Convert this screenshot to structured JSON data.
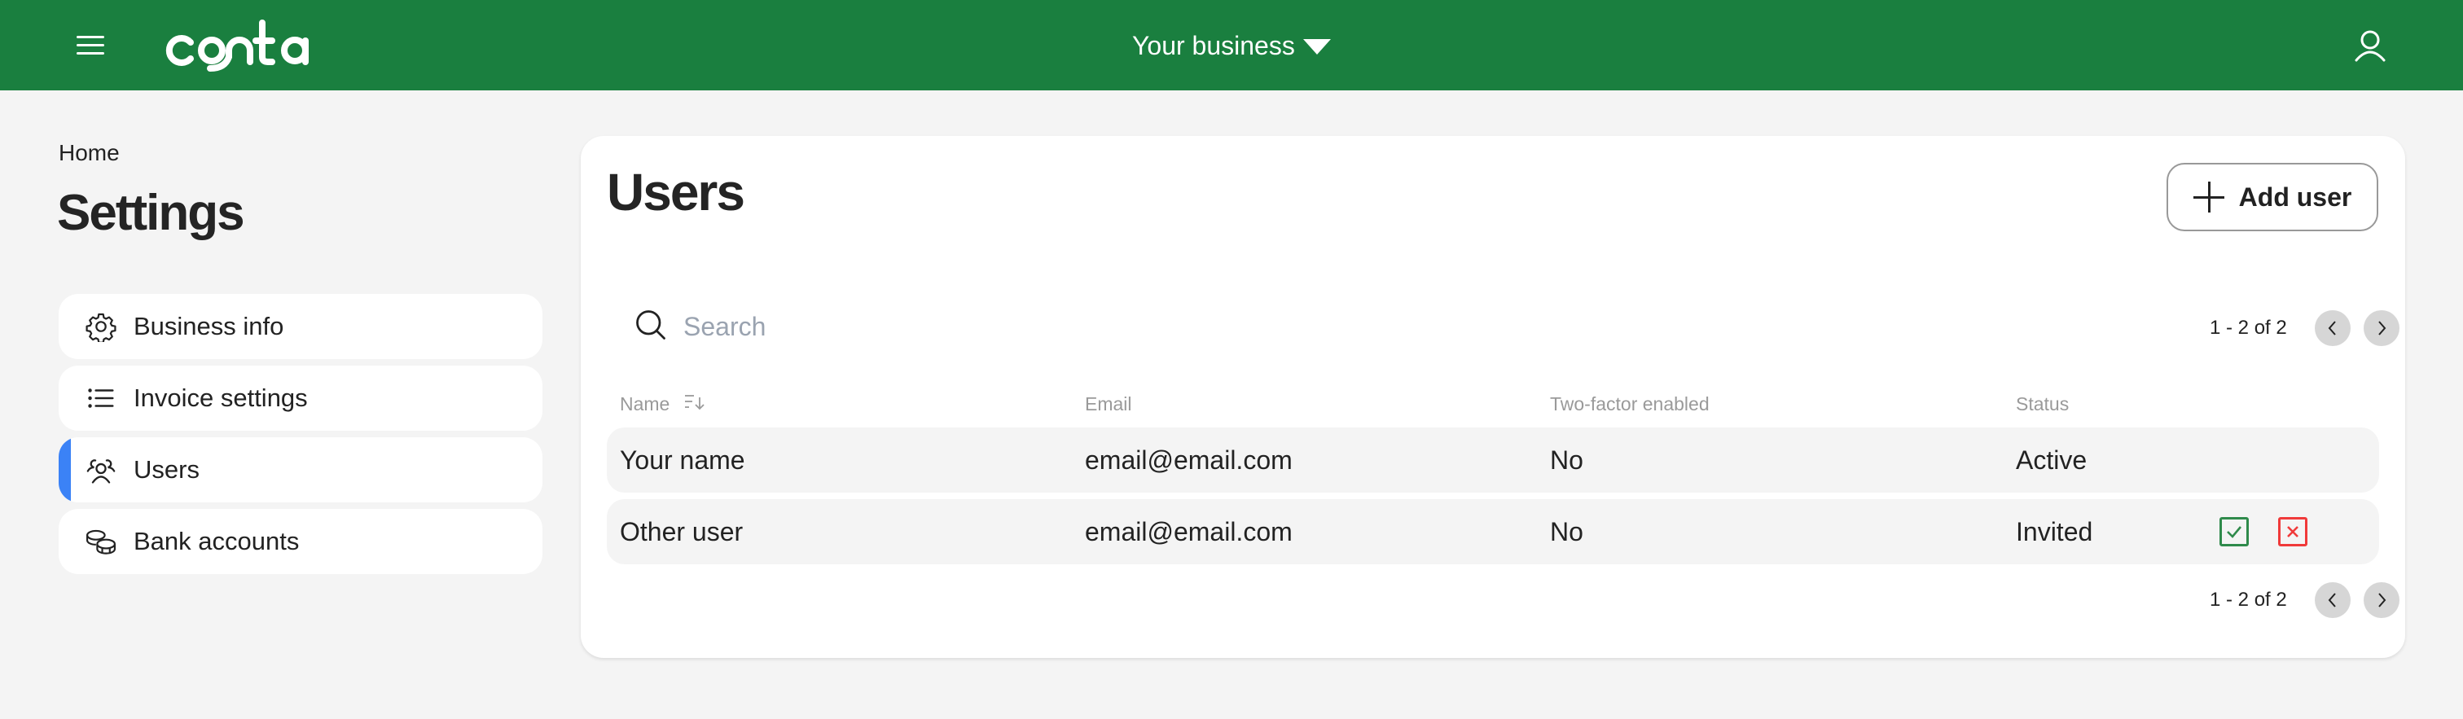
{
  "header": {
    "logo_text": "conta",
    "business_selector": "Your business",
    "brand_color": "#1a7f3f"
  },
  "breadcrumb": "Home",
  "page_title": "Settings",
  "sidebar": {
    "items": [
      {
        "label": "Business info",
        "icon": "gear-icon",
        "active": false
      },
      {
        "label": "Invoice settings",
        "icon": "list-icon",
        "active": false
      },
      {
        "label": "Users",
        "icon": "users-icon",
        "active": true
      },
      {
        "label": "Bank accounts",
        "icon": "coins-icon",
        "active": false
      }
    ],
    "active_indicator_color": "#3b82f6"
  },
  "main": {
    "title": "Users",
    "add_user_label": "Add user",
    "search_placeholder": "Search",
    "search_value": "",
    "pagination": {
      "range_text": "1 - 2 of 2"
    },
    "table": {
      "columns": [
        "Name",
        "Email",
        "Two-factor enabled",
        "Status"
      ],
      "rows": [
        {
          "name": "Your name",
          "email": "email@email.com",
          "two_factor": "No",
          "status": "Active",
          "actions": []
        },
        {
          "name": "Other user",
          "email": "email@email.com",
          "two_factor": "No",
          "status": "Invited",
          "actions": [
            "accept",
            "reject"
          ]
        }
      ]
    },
    "action_colors": {
      "accept": "#2f8a4b",
      "reject": "#f03a3a"
    }
  }
}
